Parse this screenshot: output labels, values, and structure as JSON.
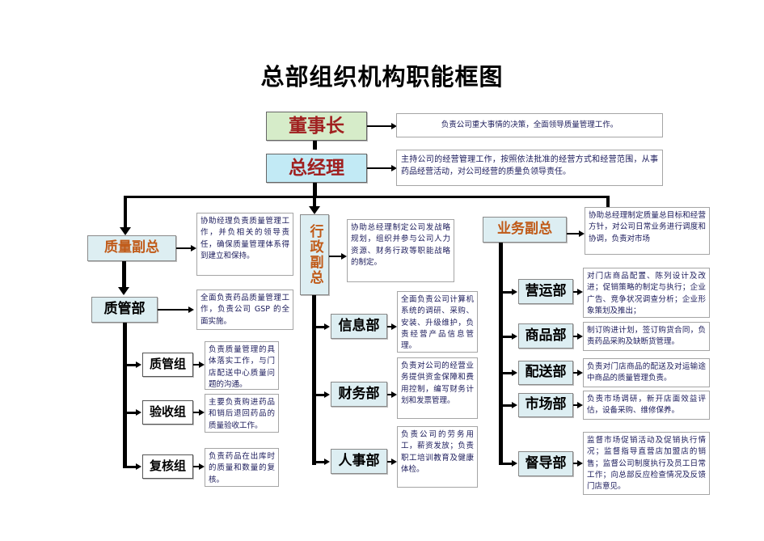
{
  "page": {
    "title": "总部组织机构职能框图"
  },
  "colors": {
    "chairman_box": "#d6ecc9",
    "gm_box": "#c2eaf5",
    "vp_box": "#ddeef2",
    "dept_box": "#ddeef2",
    "top_text": "#a02020",
    "vp_text": "#c05a18",
    "desc_text": "#1a1a5a",
    "connector": "#000000"
  },
  "top": {
    "chairman": {
      "label": "董事长",
      "desc": "负责公司重大事情的决策，全面领导质量管理工作。"
    },
    "general_manager": {
      "label": "总经理",
      "desc": "主持公司的经营管理工作，按照依法批准的经营方式和经营范围，从事药品经营活动，对公司经营的质量负领导责任。"
    }
  },
  "branches": {
    "quality": {
      "vp": {
        "label": "质量副总",
        "desc": "协助经理负责质量管理工作，并负相关的领导责任，确保质量管理体系得到建立和保持。"
      },
      "dept": {
        "label": "质管部",
        "desc": "全面负责药品质量管理工作，负责公司 GSP 的全面实施。"
      },
      "groups": [
        {
          "label": "质管组",
          "desc": "负责质量管理的具体落实工作，与门店配送中心质量问题的沟通。"
        },
        {
          "label": "验收组",
          "desc": "主要负责购进药品和销后退回药品的质量验收工作。"
        },
        {
          "label": "复核组",
          "desc": "负责药品在出库时的质量和数量的复核。"
        }
      ]
    },
    "admin": {
      "vp": {
        "label": "行政副总",
        "desc": "协助总经理制定公司发战略规划，组织并参与公司人力资源、财务行政等职能战略的制定。"
      },
      "depts": [
        {
          "label": "信息部",
          "desc": "全面负责公司计算机系统的调研、采购、安装、升级维护，负责经营产品信息管理。"
        },
        {
          "label": "财务部",
          "desc": "负责对公司的经营业务提供资金保障和费用控制，编写财务计划和发票管理。"
        },
        {
          "label": "人事部",
          "desc": "负责公司的劳务用工，薪资发放；负责职工培训教育及健康体检。"
        }
      ]
    },
    "business": {
      "vp": {
        "label": "业务副总",
        "desc": "协助总经理制定质量总目标和经营方针，对公司日常业务进行调度和协调，负责对市场"
      },
      "depts": [
        {
          "label": "营运部",
          "desc": "对门店商品配置、陈列设计及改进；促销策略的制定与执行；企业广告、竞争状况调查分析；企业形象策划及推出；"
        },
        {
          "label": "商品部",
          "desc": "制订购进计划，签订购货合同，负责药品采购及缺断货管理。"
        },
        {
          "label": "配送部",
          "desc": "负责对门店商品的配送及对运输途中商品的质量管理负责。"
        },
        {
          "label": "市场部",
          "desc": "负责市场调研，新开店面效益评估，设备采购、维修保养。"
        },
        {
          "label": "督导部",
          "desc": "监督市场促销活动及促销执行情况；监督指导直营店加盟店的销售；监督公司制度执行及员工日常工作；向总部反应检查情况及反馈门店意见。"
        }
      ]
    }
  }
}
